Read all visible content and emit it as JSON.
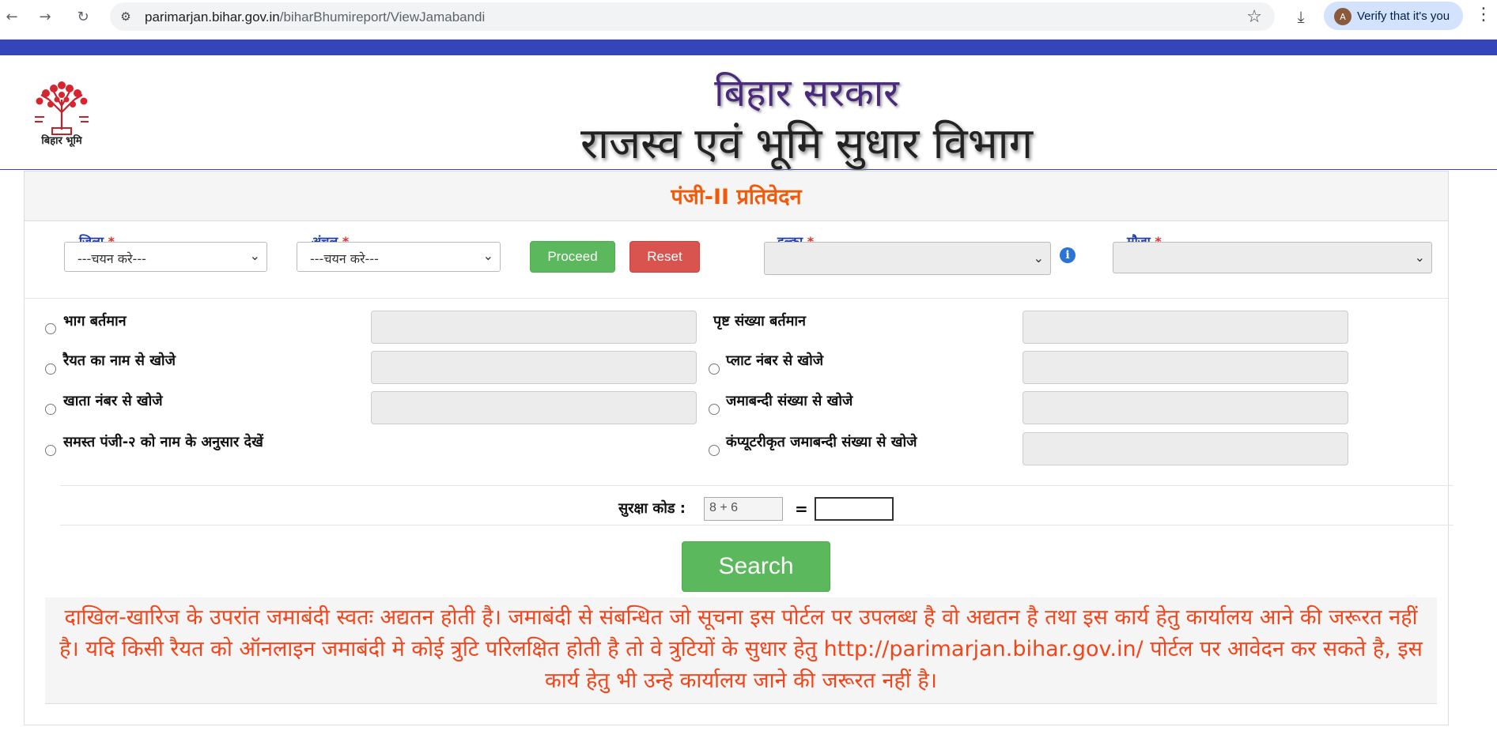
{
  "browser": {
    "url_host": "parimarjan.bihar.gov.in",
    "url_path": "/biharBhumireport/ViewJamabandi",
    "profile_initial": "A",
    "profile_prompt": "Verify that it's you",
    "icons": [
      "back-arrow-icon",
      "forward-arrow-icon",
      "reload-icon",
      "site-settings-icon",
      "bookmark-star-icon",
      "download-icon",
      "menu-kebab-icon"
    ]
  },
  "header": {
    "logo_text": "बिहार भूमि",
    "gov_title": "बिहार सरकार",
    "dept_title": "राजस्व एवं भूमि सुधार विभाग"
  },
  "panel": {
    "title": "पंजी-II प्रतिवेदन"
  },
  "filters": {
    "district": {
      "label": "जिला",
      "value": "---चयन करे---"
    },
    "circle": {
      "label": "अंचल",
      "value": "---चयन करे---"
    },
    "proceed_label": "Proceed",
    "reset_label": "Reset",
    "halka": {
      "label": "हल्का",
      "value": ""
    },
    "mauja": {
      "label": "मौजा",
      "value": ""
    },
    "required_mark": "*"
  },
  "search_options": {
    "left": [
      {
        "label": "भाग बर्तमान"
      },
      {
        "label": "रैयत का नाम से खोजे"
      },
      {
        "label": "खाता नंबर से खोजे"
      },
      {
        "label": "समस्त पंजी-२ को नाम के अनुसार देखें"
      }
    ],
    "right": [
      {
        "label": "पृष्ट संख्या बर्तमान"
      },
      {
        "label": "प्लाट नंबर से खोजे"
      },
      {
        "label": "जमाबन्दी संख्या से खोजे"
      },
      {
        "label": "कंप्यूटरीकृत जमाबन्दी संख्या से खोजे"
      }
    ]
  },
  "captcha": {
    "label": "सुरक्षा कोड :",
    "question": "8 + 6",
    "equals": "=",
    "answer": ""
  },
  "search_label": "Search",
  "notice": "दाखिल-खारिज के उपरांत जमाबंदी स्वतः अद्यतन होती है। जमाबंदी से संबन्धित जो सूचना इस पोर्टल पर उपलब्ध है वो अद्यतन है तथा इस कार्य हेतु कार्यालय आने की जरूरत नहीं है। यदि किसी रैयत को ऑनलाइन जमाबंदी मे कोई त्रुटि परिलक्षित होती है तो वे त्रुटियों के सुधार हेतु http://parimarjan.bihar.gov.in/ पोर्टल पर आवेदन कर सकते है, इस कार्य हेतु भी उन्हे कार्यालय जाने की जरूरत नहीं है।",
  "colors": {
    "top_bar": "#3345b7",
    "title_orange": "#f15a0a",
    "label_blue": "#1f3ea8",
    "notice_red": "#f2451a",
    "btn_green": "#5cb85c",
    "btn_red": "#d9534f"
  }
}
